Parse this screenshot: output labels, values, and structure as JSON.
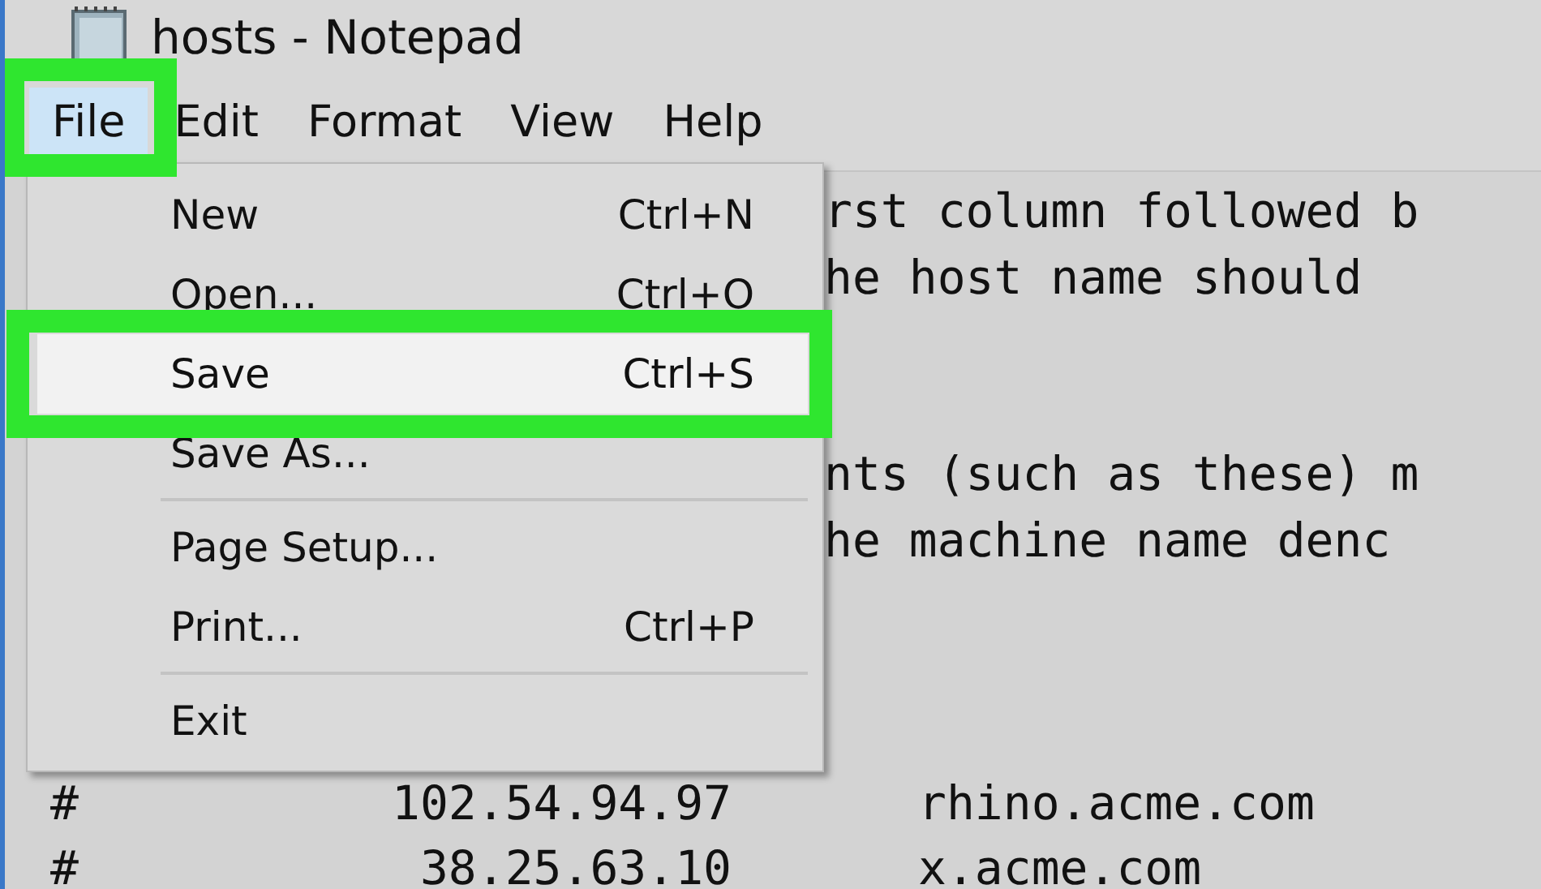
{
  "window": {
    "title": "hosts - Notepad"
  },
  "menu_bar": [
    {
      "label": "File",
      "selected": true,
      "highlighted": true
    },
    {
      "label": "Edit",
      "selected": false,
      "highlighted": false
    },
    {
      "label": "Format",
      "selected": false,
      "highlighted": false
    },
    {
      "label": "View",
      "selected": false,
      "highlighted": false
    },
    {
      "label": "Help",
      "selected": false,
      "highlighted": false
    }
  ],
  "file_menu": [
    {
      "kind": "item",
      "label": "New",
      "shortcut": "Ctrl+N",
      "hovered": false,
      "highlighted": false
    },
    {
      "kind": "item",
      "label": "Open...",
      "shortcut": "Ctrl+O",
      "hovered": false,
      "highlighted": false
    },
    {
      "kind": "item",
      "label": "Save",
      "shortcut": "Ctrl+S",
      "hovered": true,
      "highlighted": true
    },
    {
      "kind": "item",
      "label": "Save As...",
      "hovered": false,
      "highlighted": false
    },
    {
      "kind": "separator"
    },
    {
      "kind": "item",
      "label": "Page Setup...",
      "hovered": false,
      "highlighted": false
    },
    {
      "kind": "item",
      "label": "Print...",
      "shortcut": "Ctrl+P",
      "hovered": false,
      "highlighted": false
    },
    {
      "kind": "separator"
    },
    {
      "kind": "item",
      "label": "Exit",
      "hovered": false,
      "highlighted": false
    }
  ],
  "editor_lines": [
    {
      "kind": "partial",
      "text": "rst column followed b"
    },
    {
      "kind": "partial",
      "text": "he host name should"
    },
    {
      "kind": "blank"
    },
    {
      "kind": "blank"
    },
    {
      "kind": "partial",
      "text": "nts (such as these) m"
    },
    {
      "kind": "partial",
      "text": "he machine name denc"
    },
    {
      "kind": "blank"
    },
    {
      "kind": "blank"
    },
    {
      "kind": "blank"
    },
    {
      "kind": "entry",
      "comment": "#",
      "address": "102.54.94.97",
      "host": "rhino.acme.com"
    },
    {
      "kind": "entry",
      "comment": "#",
      "address": "38.25.63.10",
      "host": "x.acme.com"
    }
  ]
}
